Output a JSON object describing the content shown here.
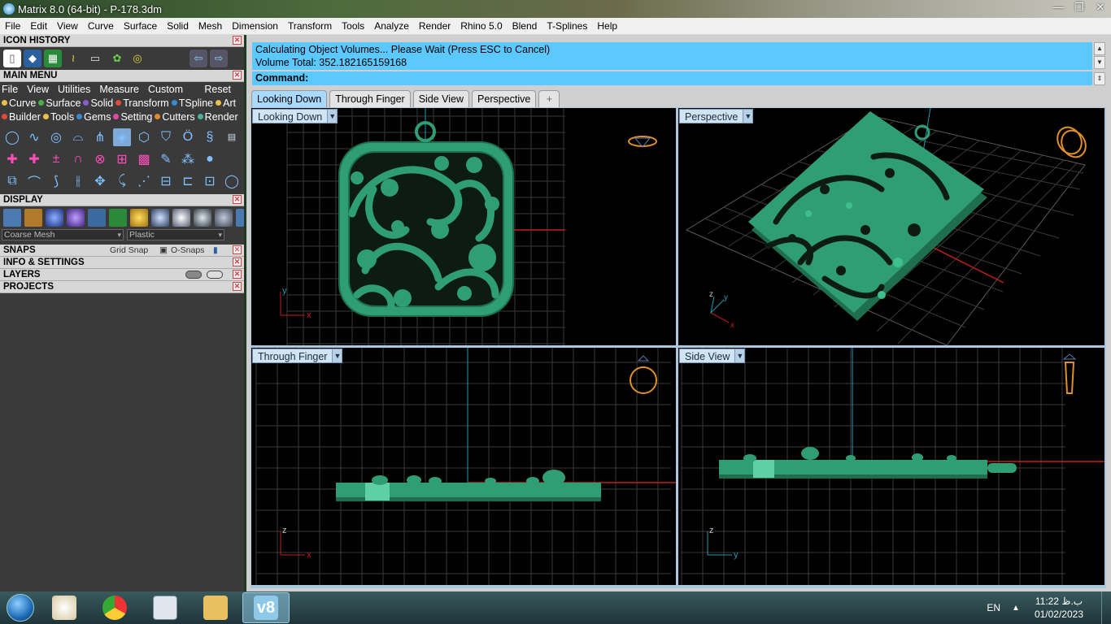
{
  "window": {
    "title": "Matrix 8.0 (64-bit) - P-178.3dm",
    "controls": [
      "—",
      "❐",
      "✕"
    ]
  },
  "menubar": [
    "File",
    "Edit",
    "View",
    "Curve",
    "Surface",
    "Solid",
    "Mesh",
    "Dimension",
    "Transform",
    "Tools",
    "Analyze",
    "Render",
    "Rhino 5.0",
    "Blend",
    "T-Splines",
    "Help"
  ],
  "left_panel": {
    "icon_history": {
      "title": "ICON HISTORY"
    },
    "main_menu": {
      "title": "MAIN MENU",
      "menus": [
        "File",
        "View",
        "Utilities",
        "Measure",
        "Custom"
      ],
      "reset": "Reset",
      "categories_row1": [
        {
          "label": "Curve",
          "color": "#e8c04a"
        },
        {
          "label": "Surface",
          "color": "#4ab04a"
        },
        {
          "label": "Solid",
          "color": "#8a5ad0"
        },
        {
          "label": "Transform",
          "color": "#e04a3a"
        },
        {
          "label": "TSpline",
          "color": "#3a8ad0"
        },
        {
          "label": "Art",
          "color": "#e8c04a"
        }
      ],
      "categories_row2": [
        {
          "label": "Builder",
          "color": "#e04a3a"
        },
        {
          "label": "Tools",
          "color": "#e8c04a"
        },
        {
          "label": "Gems",
          "color": "#3a8ad0"
        },
        {
          "label": "Setting",
          "color": "#e04aa0"
        },
        {
          "label": "Cutters",
          "color": "#e08a2a"
        },
        {
          "label": "Render",
          "color": "#4ab0a0"
        }
      ]
    },
    "display": {
      "title": "DISPLAY",
      "mesh_select": "Coarse Mesh",
      "material_select": "Plastic"
    },
    "snaps": {
      "title": "SNAPS",
      "grid_snap": "Grid Snap",
      "o_snaps": "O-Snaps"
    },
    "info": {
      "title": "INFO & SETTINGS"
    },
    "layers": {
      "title": "LAYERS"
    },
    "projects": {
      "title": "PROJECTS"
    }
  },
  "command": {
    "history_line1": "Calculating Object Volumes... Please Wait (Press ESC to Cancel)",
    "history_line2": "Volume Total: 352.182165159168",
    "prompt": "Command:"
  },
  "viewport_tabs": [
    "Looking Down",
    "Through Finger",
    "Side View",
    "Perspective",
    "+"
  ],
  "viewports": {
    "top_left": "Looking Down",
    "top_right": "Perspective",
    "bottom_left": "Through Finger",
    "bottom_right": "Side View"
  },
  "axes": {
    "x": "x",
    "y": "y",
    "z": "z"
  },
  "colors": {
    "model": "#2f9e75",
    "model_dark": "#1f6e50",
    "grid": "#3a3a3a",
    "grid_major": "#5a5a5a",
    "axis_red": "#c0201c",
    "axis_blue": "#1e9ab0",
    "gumball_orange": "#e0902a",
    "cmd_bg": "#5bc8ff",
    "tab_active": "#a9d9ff"
  },
  "taskbar": {
    "apps": [
      "start-orb",
      "paint",
      "chrome",
      "calculator",
      "explorer",
      "matrix-v8"
    ],
    "active_label": "v8",
    "lang": "EN",
    "time": "11:22 ب.ظ",
    "date": "01/02/2023"
  }
}
